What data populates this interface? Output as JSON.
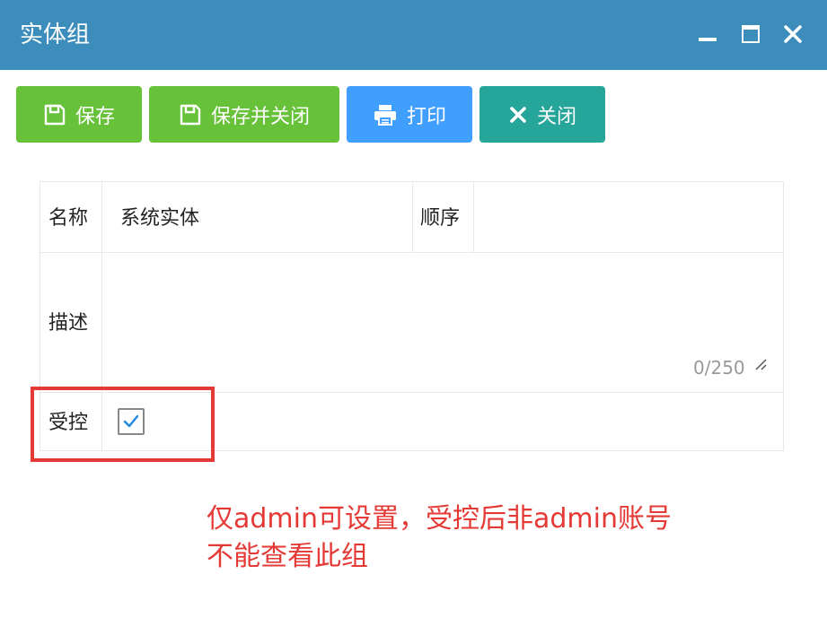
{
  "window": {
    "title": "实体组",
    "minimize_icon": "minimize-icon",
    "maximize_icon": "maximize-icon",
    "close_icon": "close-icon"
  },
  "toolbar": {
    "buttons": [
      {
        "label": "保存",
        "icon": "save-icon",
        "color": "#67c23a"
      },
      {
        "label": "保存并关闭",
        "icon": "save-icon",
        "color": "#67c23a"
      },
      {
        "label": "打印",
        "icon": "print-icon",
        "color": "#409eff"
      },
      {
        "label": "关闭",
        "icon": "close-icon",
        "color": "#26a69a"
      }
    ]
  },
  "form": {
    "name_label": "名称",
    "name_value": "系统实体",
    "order_label": "顺序",
    "order_value": "",
    "description_label": "描述",
    "description_value": "",
    "description_counter": "0/250",
    "controlled_label": "受控",
    "controlled_checked": true
  },
  "annotation": {
    "line1": "仅admin可设置，受控后非admin账号",
    "line2": "不能查看此组",
    "color": "#e53935"
  }
}
